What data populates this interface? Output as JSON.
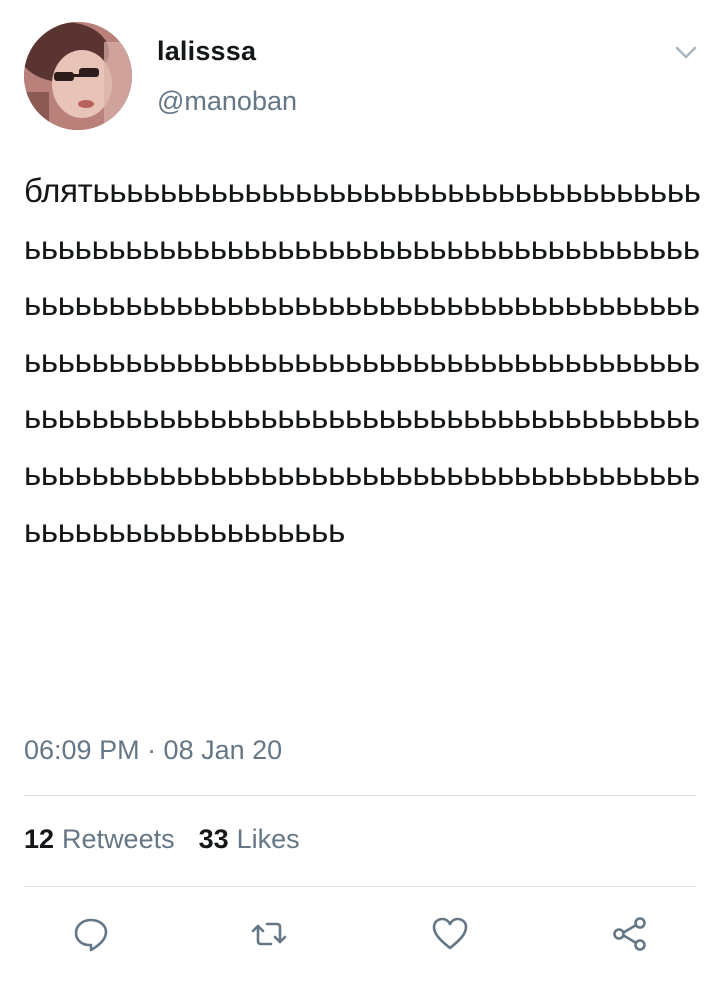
{
  "user": {
    "display_name": "lalisssa",
    "handle": "@manoban"
  },
  "tweet": {
    "text": "блятььььььььььььььььььььььььььььььььььььььььььььььььььььььььььььььььььььььььььььььььььььььььььььььььььььььььььььььььььььььььььььььььььььььььььььььььььььььььььььььььььььььььььььььььььььььььььььььььььььььььььььььььььььььььььььььььььььььььььььььььььььььььььььььь",
    "timestamp": "06:09 PM · 08 Jan 20"
  },
  "stats": {
    "retweets_count": "12",
    "retweets_label": "Retweets",
    "likes_count": "33",
    "likes_label": "Likes"
  },
  "icons": {
    "more": "chevron-down-icon",
    "reply": "reply-icon",
    "retweet": "retweet-icon",
    "like": "heart-icon",
    "share": "share-icon"
  },
  "colors": {
    "text": "#14171a",
    "secondary": "#657786",
    "icon": "#657786",
    "divider": "#dde2e6"
  }
}
